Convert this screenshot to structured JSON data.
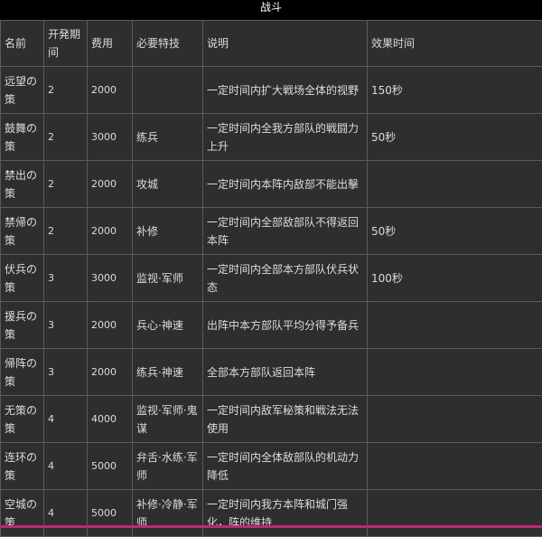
{
  "title": "战斗",
  "columns": [
    "名前",
    "开発期间",
    "费用",
    "必要特技",
    "说明",
    "效果时间"
  ],
  "rows": [
    {
      "name": "远望の策",
      "period": "2",
      "cost": "2000",
      "skill": "",
      "desc": "一定时间内扩大戦场全体的视野",
      "time": "150秒"
    },
    {
      "name": "鼓舞の策",
      "period": "2",
      "cost": "3000",
      "skill": "练兵",
      "desc": "一定时间内全我方部队的戦闘力上升",
      "time": "50秒"
    },
    {
      "name": "禁出の策",
      "period": "2",
      "cost": "2000",
      "skill": "攻城",
      "desc": "一定时间内本阵内敌部不能出擊",
      "time": ""
    },
    {
      "name": "禁帰の策",
      "period": "2",
      "cost": "2000",
      "skill": "补修",
      "desc": "一定时间内全部敌部队不得返回本阵",
      "time": "50秒"
    },
    {
      "name": "伏兵の策",
      "period": "3",
      "cost": "3000",
      "skill": "监视·军师",
      "desc": "一定时间内全部本方部队伏兵状态",
      "time": "100秒"
    },
    {
      "name": "援兵の策",
      "period": "3",
      "cost": "2000",
      "skill": "兵心·神速",
      "desc": "出阵中本方部队平均分得予备兵",
      "time": ""
    },
    {
      "name": "帰阵の策",
      "period": "3",
      "cost": "2000",
      "skill": "练兵·神速",
      "desc": "全部本方部队返回本阵",
      "time": ""
    },
    {
      "name": "无策の策",
      "period": "4",
      "cost": "4000",
      "skill": "监视·军师·鬼谋",
      "desc": "一定时间内敌军秘策和戦法无法使用",
      "time": ""
    },
    {
      "name": "连环の策",
      "period": "4",
      "cost": "5000",
      "skill": "弁舌·水练·军师",
      "desc": "一定时间内全体敌部队的机动力降低",
      "time": ""
    },
    {
      "name": "空城の策",
      "period": "4",
      "cost": "5000",
      "skill": "补修·冷静·军师",
      "desc": "一定时间内我方本阵和城门强化，阵的维持",
      "time": ""
    }
  ]
}
